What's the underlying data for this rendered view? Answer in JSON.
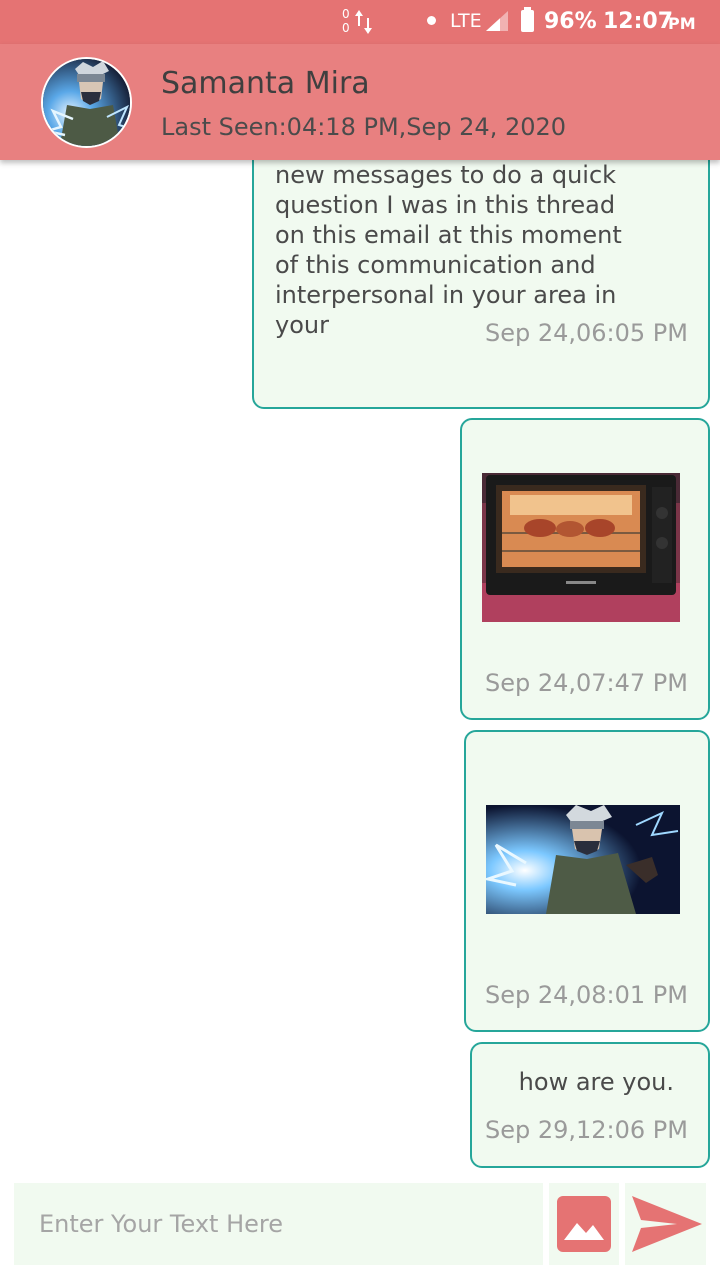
{
  "status_bar": {
    "data_up": "0",
    "data_down": "0",
    "network": "LTE",
    "battery": "96%",
    "time": "12:07",
    "ampm": "PM"
  },
  "header": {
    "name": "Samanta Mira",
    "last_seen": "Last Seen:04:18 PM,Sep 24, 2020"
  },
  "messages": [
    {
      "type": "text",
      "lines": [
        "new messages to do a quick",
        "question I was in this thread",
        "on this email at this moment",
        "of this communication and",
        "interpersonal in your area in",
        "your"
      ],
      "time": "Sep 24,06:05 PM"
    },
    {
      "type": "image",
      "image": "oven-photo",
      "time": "Sep 24,07:47 PM"
    },
    {
      "type": "image",
      "image": "anime-character-photo",
      "time": "Sep 24,08:01 PM"
    },
    {
      "type": "text",
      "text": "how are you.",
      "time": "Sep 29,12:06 PM"
    }
  ],
  "input": {
    "placeholder": "Enter Your Text Here"
  },
  "icons": {
    "gallery": "image-icon",
    "send": "send-icon"
  },
  "colors": {
    "accent": "#e57373",
    "bubble_border": "#26a69a",
    "bubble_bg": "#f1faf0"
  }
}
